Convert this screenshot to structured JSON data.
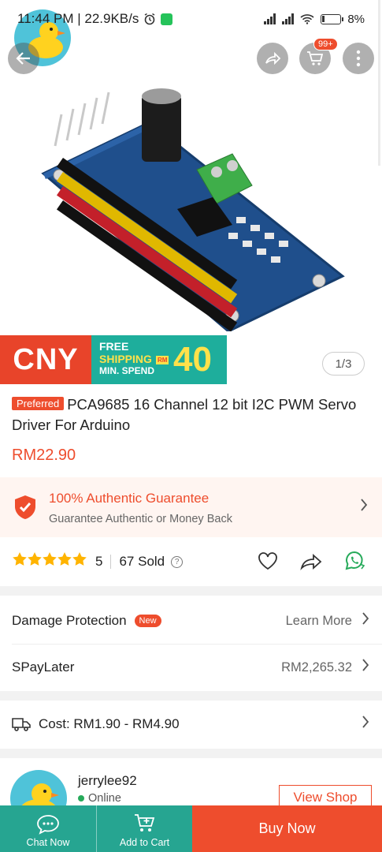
{
  "status_bar": {
    "time_speed": "11:44 PM | 22.9KB/s",
    "battery": "8%"
  },
  "header": {
    "cart_badge": "99+"
  },
  "gallery": {
    "counter": "1/3",
    "promo": {
      "cny": "CNY",
      "line1": "FREE",
      "line2": "SHIPPING",
      "line3": "MIN. SPEND",
      "currency": "RM",
      "amount": "40"
    }
  },
  "product": {
    "badge": "Preferred",
    "title": "PCA9685 16 Channel 12 bit I2C PWM Servo Driver For Arduino",
    "price": "RM22.90"
  },
  "guarantee": {
    "title": "100% Authentic Guarantee",
    "subtitle": "Guarantee Authentic or Money Back"
  },
  "rating": {
    "stars": 5,
    "value": "5",
    "sold": "67 Sold"
  },
  "damage_protection": {
    "label": "Damage Protection",
    "badge": "New",
    "action": "Learn More"
  },
  "spaylater": {
    "label": "SPayLater",
    "value": "RM2,265.32"
  },
  "shipping": {
    "cost": "Cost: RM1.90 - RM4.90"
  },
  "shop": {
    "name": "jerrylee92",
    "status": "Online",
    "button": "View Shop"
  },
  "bottom_bar": {
    "chat": "Chat Now",
    "cart": "Add to Cart",
    "buy": "Buy Now"
  },
  "colors": {
    "brand": "#ee4d2d",
    "teal": "#26a591",
    "star": "#ffb400"
  }
}
